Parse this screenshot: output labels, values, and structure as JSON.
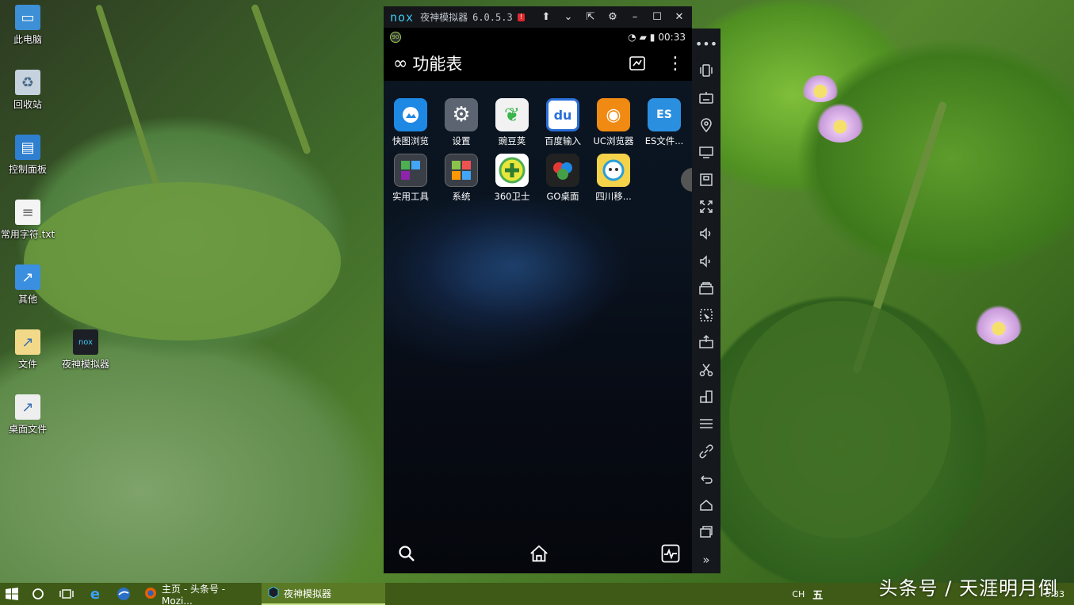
{
  "desktop": {
    "icons": [
      {
        "label": "此电脑",
        "icon": "computer-icon"
      },
      {
        "label": "回收站",
        "icon": "recycle-bin-icon"
      },
      {
        "label": "控制面板",
        "icon": "control-panel-icon"
      },
      {
        "label": "常用字符.txt",
        "icon": "text-file-icon"
      },
      {
        "label": "其他",
        "icon": "shortcut-icon"
      },
      {
        "label": "文件",
        "icon": "folder-shortcut-icon"
      },
      {
        "label": "夜神模拟器",
        "icon": "nox-icon"
      },
      {
        "label": "桌面文件",
        "icon": "folder-shortcut-icon"
      }
    ]
  },
  "emulator": {
    "logo": "nox",
    "title": "夜神模拟器",
    "version": "6.0.5.3",
    "alert": "!",
    "status": {
      "badge": "90",
      "time": "00:33"
    },
    "header": {
      "title": "功能表"
    },
    "apps": [
      {
        "label": "快图浏览",
        "icon_text": "",
        "color": "#1e88e5"
      },
      {
        "label": "设置",
        "icon_text": "⚙",
        "color": "#5b6470"
      },
      {
        "label": "豌豆荚",
        "icon_text": "",
        "color": "#f2f2f2"
      },
      {
        "label": "百度输入",
        "icon_text": "du",
        "color": "#2a6fd8"
      },
      {
        "label": "UC浏览器",
        "icon_text": "",
        "color": "#f08a12"
      },
      {
        "label": "ES文件...",
        "icon_text": "ES",
        "color": "#2b8fe0"
      },
      {
        "label": "实用工具",
        "icon_text": "",
        "color": "#3a3f47"
      },
      {
        "label": "系统",
        "icon_text": "",
        "color": "#3a3f47"
      },
      {
        "label": "360卫士",
        "icon_text": "+",
        "color": "#e8e63a"
      },
      {
        "label": "GO桌面",
        "icon_text": "",
        "color": "#222"
      },
      {
        "label": "四川移...",
        "icon_text": "",
        "color": "#f4d24a"
      }
    ]
  },
  "taskbar": {
    "tasks": [
      {
        "label": "主页 - 头条号 - Mozi..."
      },
      {
        "label": "夜神模拟器"
      }
    ],
    "tray": {
      "lang": "CH",
      "ime": "五",
      "time": "0:33"
    }
  },
  "watermark": "头条号 / 天涯明月倒"
}
